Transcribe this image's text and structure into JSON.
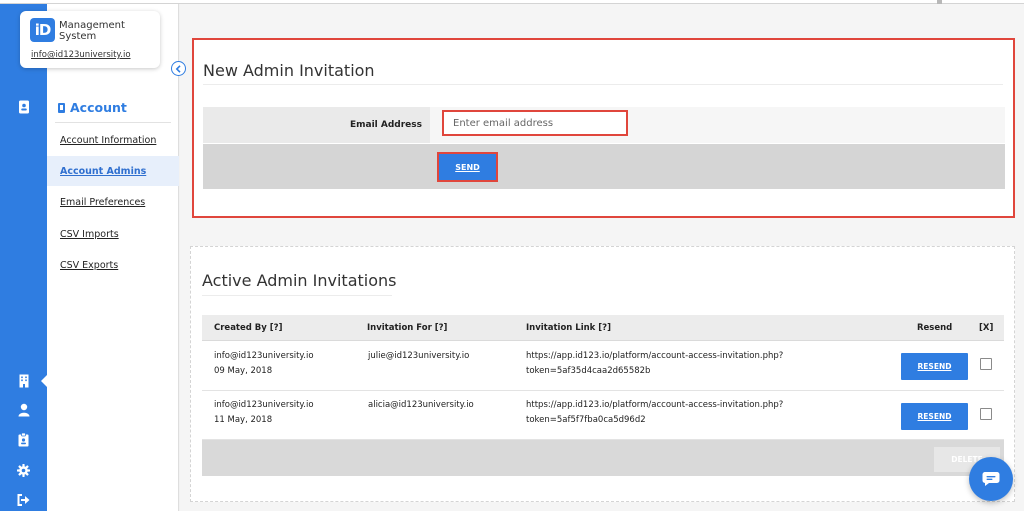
{
  "app": {
    "logo_text": "iD",
    "title": "Management System",
    "user_email": "info@id123university.io"
  },
  "rail": {
    "icons": [
      "id-card-icon",
      "building-icon",
      "user-icon",
      "badge-icon",
      "gear-icon",
      "logout-icon"
    ],
    "active": "building-icon"
  },
  "subnav": {
    "heading": "Account",
    "items": [
      {
        "label": "Account Information",
        "active": false
      },
      {
        "label": "Account Admins",
        "active": true
      },
      {
        "label": "Email Preferences",
        "active": false
      },
      {
        "label": "CSV Imports",
        "active": false
      },
      {
        "label": "CSV Exports",
        "active": false
      }
    ]
  },
  "invite": {
    "title": "New Admin Invitation",
    "email_label": "Email Address",
    "email_placeholder": "Enter email address",
    "email_value": "",
    "send_label": "SEND"
  },
  "active": {
    "title": "Active Admin Invitations",
    "columns": {
      "created_by": "Created By [?]",
      "invitation_for": "Invitation For [?]",
      "link": "Invitation Link [?]",
      "resend": "Resend",
      "remove": "[X]"
    },
    "rows": [
      {
        "created_by": "info@id123university.io",
        "date": "09 May, 2018",
        "invitation_for": "julie@id123university.io",
        "link_line1": "https://app.id123.io/platform/account-access-invitation.php?",
        "link_line2": "token=5af35d4caa2d65582b",
        "resend_label": "RESEND",
        "checked": false
      },
      {
        "created_by": "info@id123university.io",
        "date": "11 May, 2018",
        "invitation_for": "alicia@id123university.io",
        "link_line1": "https://app.id123.io/platform/account-access-invitation.php?",
        "link_line2": "token=5af5f7fba0ca5d96d2",
        "resend_label": "RESEND",
        "checked": false
      }
    ],
    "delete_label": "DELETE"
  },
  "colors": {
    "brand_blue": "#2f7de1",
    "highlight_red": "#e0463c"
  },
  "chat": {
    "icon": "chat-bubble-icon"
  }
}
